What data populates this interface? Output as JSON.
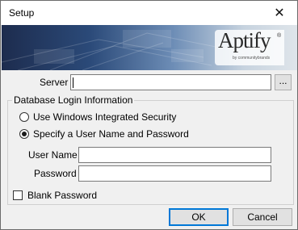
{
  "window": {
    "title": "Setup",
    "close_glyph": "✕"
  },
  "banner": {
    "logo_text": "Aptify",
    "logo_mark": "®",
    "logo_tagline": "by communitybrands"
  },
  "server": {
    "label": "Server",
    "value": "",
    "browse_label": "..."
  },
  "login_group": {
    "title": "Database Login Information",
    "options": [
      {
        "label": "Use Windows Integrated Security",
        "selected": false
      },
      {
        "label": "Specify a User Name and Password",
        "selected": true
      }
    ],
    "username": {
      "label": "User Name",
      "value": ""
    },
    "password": {
      "label": "Password",
      "value": ""
    },
    "blank_password": {
      "label": "Blank Password",
      "checked": false
    }
  },
  "buttons": {
    "ok": "OK",
    "cancel": "Cancel"
  },
  "icons": {
    "close": "close-icon",
    "browse": "ellipsis-icon",
    "logo": "aptify-logo"
  }
}
